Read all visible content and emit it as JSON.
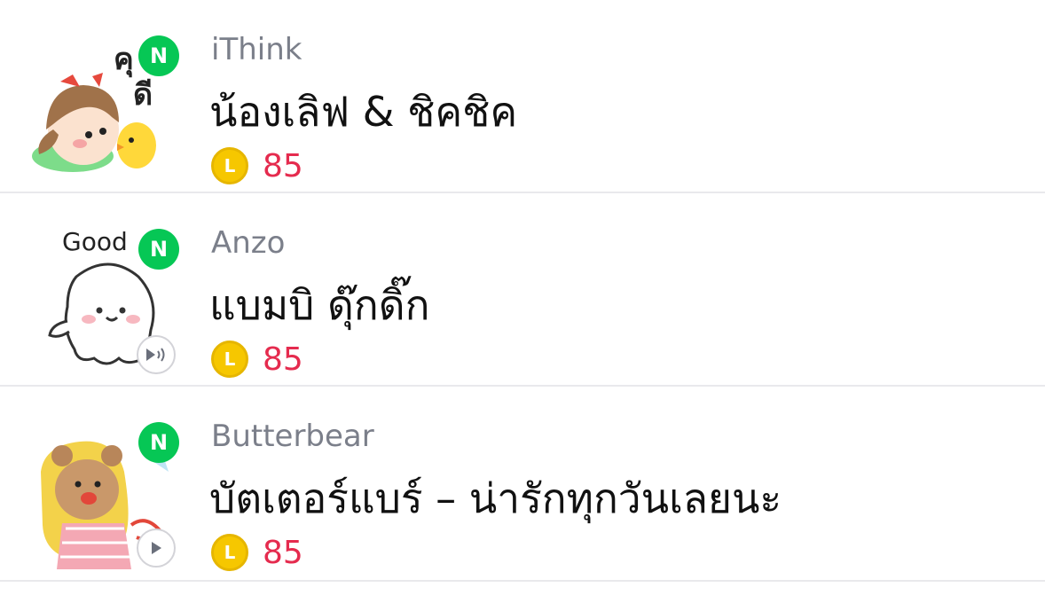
{
  "items": [
    {
      "author": "iThink",
      "title": "น้องเลิฟ & ชิคชิค",
      "price": "85",
      "badge": "N",
      "coin": "L",
      "thumb_text": "คุณดี",
      "indicator": "none"
    },
    {
      "author": "Anzo",
      "title": "แบมบิ ดุ๊กดิ๊ก",
      "price": "85",
      "badge": "N",
      "coin": "L",
      "thumb_text": "Good",
      "indicator": "sound-icon"
    },
    {
      "author": "Butterbear",
      "title": "บัตเตอร์แบร์ – น่ารักทุกวันเลยนะ",
      "price": "85",
      "badge": "N",
      "coin": "L",
      "thumb_text": "",
      "indicator": "play-icon"
    }
  ],
  "colors": {
    "new_badge": "#06c755",
    "price": "#e52b4e",
    "coin": "#f6c700",
    "author": "#7b7f8a"
  }
}
